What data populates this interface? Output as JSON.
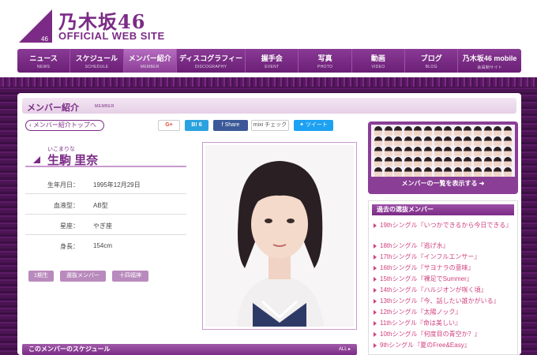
{
  "logo": {
    "jp": "乃木坂46",
    "en": "OFFICIAL WEB SITE",
    "mark_num": "46"
  },
  "nav": [
    {
      "jp": "ニュース",
      "en": "NEWS"
    },
    {
      "jp": "スケジュール",
      "en": "SCHEDULE"
    },
    {
      "jp": "メンバー紹介",
      "en": "MEMBER"
    },
    {
      "jp": "ディスコグラフィー",
      "en": "DISCOGRAPHY"
    },
    {
      "jp": "握手会",
      "en": "EVENT"
    },
    {
      "jp": "写真",
      "en": "PHOTO"
    },
    {
      "jp": "動画",
      "en": "VIDEO"
    },
    {
      "jp": "ブログ",
      "en": "BLOG"
    },
    {
      "jp": "乃木坂46 mobile",
      "en": "会員制サイト"
    }
  ],
  "page": {
    "title": "メンバー紹介",
    "title_en": "MEMBER",
    "back": "メンバー紹介トップへ"
  },
  "share": {
    "google": "G+",
    "hatena": "B! 6",
    "facebook": "Share",
    "mixi": "mixi チェック",
    "twitter": "ツイート"
  },
  "member": {
    "furigana": "いこまりな",
    "name": "生駒 里奈",
    "profile": [
      {
        "k": "生年月日：",
        "v": "1995年12月29日"
      },
      {
        "k": "血液型：",
        "v": "AB型"
      },
      {
        "k": "星座：",
        "v": "やぎ座"
      },
      {
        "k": "身長：",
        "v": "154cm"
      }
    ],
    "tags": [
      "1期生",
      "選抜メンバー",
      "十四福神"
    ]
  },
  "schedule": {
    "title": "このメンバーのスケジュール",
    "all": "ALL"
  },
  "members_box": {
    "button": "メンバーの一覧を表示する"
  },
  "past": {
    "title": "過去の選抜メンバー",
    "items": [
      "19thシングル『いつかできるから今日できる』",
      "18thシングル『逃げ水』",
      "17thシングル『インフルエンサー』",
      "16thシングル『サヨナラの意味』",
      "15thシングル『裸足でSummer』",
      "14thシングル『ハルジオンが咲く頃』",
      "13thシングル『今、話したい誰かがいる』",
      "12thシングル『太陽ノック』",
      "11thシングル『命は美しい』",
      "10thシングル『何度目の青空か？』",
      "9thシングル『夏のFree&Easy』"
    ]
  },
  "colors": {
    "brand": "#7b2b86",
    "link": "#d0417e"
  }
}
